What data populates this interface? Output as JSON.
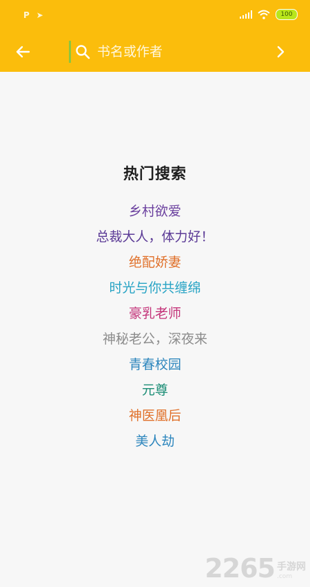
{
  "status": {
    "left_icons": [
      "p-icon",
      "send-icon"
    ],
    "battery": "100"
  },
  "search": {
    "placeholder": "书名或作者",
    "value": ""
  },
  "hot": {
    "title": "热门搜索",
    "items": [
      {
        "label": "乡村欲爱",
        "color": "#6a3f9e"
      },
      {
        "label": "总裁大人，体力好！",
        "color": "#5b3a96"
      },
      {
        "label": "绝配娇妻",
        "color": "#e0702a"
      },
      {
        "label": "时光与你共缠绵",
        "color": "#27a3c4"
      },
      {
        "label": "豪乳老师",
        "color": "#c33278"
      },
      {
        "label": "神秘老公，深夜来",
        "color": "#8c8c8c"
      },
      {
        "label": "青春校园",
        "color": "#2d86bd"
      },
      {
        "label": "元尊",
        "color": "#1a8d75"
      },
      {
        "label": "神医凰后",
        "color": "#e0702a"
      },
      {
        "label": "美人劫",
        "color": "#2d86bd"
      }
    ]
  },
  "watermark": {
    "number": "2265",
    "cn": "手游网",
    "url": ".com"
  },
  "colors": {
    "accent": "#fbbd0c",
    "background": "#f7f7f7"
  }
}
